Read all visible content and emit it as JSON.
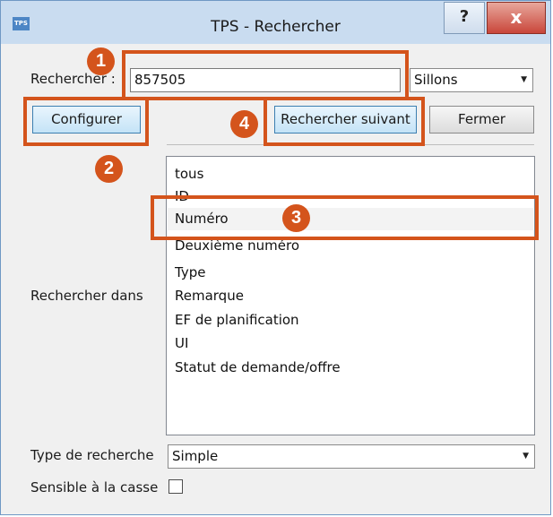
{
  "window": {
    "title": "TPS - Rechercher",
    "app_icon_text": "TPS",
    "help_label": "?",
    "close_label": "x"
  },
  "search": {
    "label": "Rechercher :",
    "value": "857505",
    "scope_value": "Sillons"
  },
  "buttons": {
    "configure": "Configurer",
    "find_next": "Rechercher suivant",
    "close": "Fermer"
  },
  "search_in": {
    "label": "Rechercher dans",
    "items": [
      "tous",
      "ID",
      "Numéro",
      "Deuxième numéro",
      "Type",
      "Remarque",
      "EF de planification",
      "UI",
      "Statut de demande/offre"
    ],
    "selected_index": 2
  },
  "search_type": {
    "label": "Type de recherche",
    "value": "Simple"
  },
  "case_sensitive": {
    "label": "Sensible à la casse",
    "checked": false
  },
  "callouts": [
    "1",
    "2",
    "3",
    "4"
  ],
  "accent_color": "#d4541c"
}
